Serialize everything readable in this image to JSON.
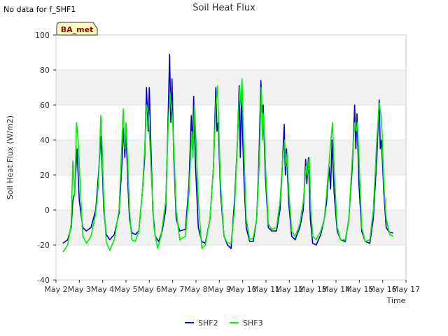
{
  "no_data_note": "No data for f_SHF1",
  "chart_data": {
    "type": "line",
    "title": "Soil Heat Flux",
    "xlabel": "Time",
    "ylabel": "Soil Heat Flux (W/m2)",
    "site_badge": "BA_met",
    "x_ticks": [
      "May 2",
      "May 3",
      "May 4",
      "May 5",
      "May 6",
      "May 7",
      "May 8",
      "May 9",
      "May 10",
      "May 11",
      "May 12",
      "May 13",
      "May 14",
      "May 15",
      "May 16",
      "May 17"
    ],
    "y_ticks": [
      "-40",
      "-20",
      "0",
      "20",
      "40",
      "60",
      "80",
      "100"
    ],
    "xlim": [
      2,
      17
    ],
    "ylim": [
      -40,
      100
    ],
    "grid": "horizontal bands",
    "legend_position": "bottom-center",
    "series": [
      {
        "name": "SHF2",
        "color": "#0000cc",
        "points": [
          [
            2.3,
            -19
          ],
          [
            2.5,
            -17
          ],
          [
            2.65,
            -10
          ],
          [
            2.72,
            5
          ],
          [
            2.8,
            10
          ],
          [
            2.9,
            35
          ],
          [
            2.95,
            20
          ],
          [
            3.0,
            5
          ],
          [
            3.15,
            -10
          ],
          [
            3.3,
            -12
          ],
          [
            3.5,
            -10
          ],
          [
            3.7,
            0
          ],
          [
            3.82,
            20
          ],
          [
            3.92,
            42
          ],
          [
            3.98,
            25
          ],
          [
            4.05,
            0
          ],
          [
            4.15,
            -14
          ],
          [
            4.3,
            -17
          ],
          [
            4.5,
            -14
          ],
          [
            4.7,
            -2
          ],
          [
            4.8,
            20
          ],
          [
            4.9,
            47
          ],
          [
            4.95,
            30
          ],
          [
            5.0,
            45
          ],
          [
            5.08,
            15
          ],
          [
            5.15,
            -5
          ],
          [
            5.25,
            -13
          ],
          [
            5.4,
            -14
          ],
          [
            5.55,
            -12
          ],
          [
            5.7,
            10
          ],
          [
            5.8,
            30
          ],
          [
            5.88,
            70
          ],
          [
            5.95,
            45
          ],
          [
            6.0,
            70
          ],
          [
            6.08,
            30
          ],
          [
            6.15,
            0
          ],
          [
            6.25,
            -15
          ],
          [
            6.4,
            -18
          ],
          [
            6.55,
            -12
          ],
          [
            6.7,
            0
          ],
          [
            6.8,
            50
          ],
          [
            6.87,
            89
          ],
          [
            6.92,
            50
          ],
          [
            6.97,
            75
          ],
          [
            7.05,
            30
          ],
          [
            7.15,
            -5
          ],
          [
            7.3,
            -12
          ],
          [
            7.55,
            -11
          ],
          [
            7.7,
            15
          ],
          [
            7.8,
            54
          ],
          [
            7.85,
            35
          ],
          [
            7.9,
            65
          ],
          [
            7.98,
            25
          ],
          [
            8.1,
            -10
          ],
          [
            8.25,
            -18
          ],
          [
            8.4,
            -19
          ],
          [
            8.6,
            -5
          ],
          [
            8.75,
            25
          ],
          [
            8.85,
            70
          ],
          [
            8.9,
            45
          ],
          [
            8.95,
            50
          ],
          [
            9.05,
            10
          ],
          [
            9.2,
            -15
          ],
          [
            9.35,
            -20
          ],
          [
            9.5,
            -22
          ],
          [
            9.65,
            5
          ],
          [
            9.78,
            40
          ],
          [
            9.85,
            71
          ],
          [
            9.9,
            30
          ],
          [
            9.95,
            65
          ],
          [
            10.05,
            20
          ],
          [
            10.15,
            -10
          ],
          [
            10.3,
            -18
          ],
          [
            10.45,
            -18
          ],
          [
            10.6,
            -5
          ],
          [
            10.7,
            30
          ],
          [
            10.78,
            74
          ],
          [
            10.83,
            55
          ],
          [
            10.88,
            60
          ],
          [
            10.97,
            20
          ],
          [
            11.1,
            -10
          ],
          [
            11.25,
            -12
          ],
          [
            11.45,
            -12
          ],
          [
            11.6,
            0
          ],
          [
            11.7,
            25
          ],
          [
            11.78,
            49
          ],
          [
            11.83,
            20
          ],
          [
            11.88,
            35
          ],
          [
            11.97,
            5
          ],
          [
            12.1,
            -15
          ],
          [
            12.25,
            -17
          ],
          [
            12.45,
            -10
          ],
          [
            12.6,
            0
          ],
          [
            12.7,
            29
          ],
          [
            12.75,
            15
          ],
          [
            12.82,
            30
          ],
          [
            12.9,
            -5
          ],
          [
            13.0,
            -19
          ],
          [
            13.15,
            -20
          ],
          [
            13.35,
            -14
          ],
          [
            13.5,
            -5
          ],
          [
            13.6,
            5
          ],
          [
            13.7,
            25
          ],
          [
            13.77,
            12
          ],
          [
            13.83,
            40
          ],
          [
            13.92,
            10
          ],
          [
            14.05,
            -12
          ],
          [
            14.2,
            -17
          ],
          [
            14.4,
            -18
          ],
          [
            14.55,
            -5
          ],
          [
            14.7,
            25
          ],
          [
            14.8,
            60
          ],
          [
            14.85,
            35
          ],
          [
            14.9,
            55
          ],
          [
            14.98,
            15
          ],
          [
            15.1,
            -12
          ],
          [
            15.25,
            -18
          ],
          [
            15.45,
            -19
          ],
          [
            15.6,
            -5
          ],
          [
            15.75,
            30
          ],
          [
            15.85,
            63
          ],
          [
            15.9,
            35
          ],
          [
            15.95,
            40
          ],
          [
            16.05,
            10
          ],
          [
            16.15,
            -10
          ],
          [
            16.3,
            -13
          ],
          [
            16.45,
            -13
          ]
        ]
      },
      {
        "name": "SHF3",
        "color": "#00ee00",
        "points": [
          [
            2.3,
            -24
          ],
          [
            2.5,
            -20
          ],
          [
            2.65,
            -8
          ],
          [
            2.72,
            28
          ],
          [
            2.8,
            8
          ],
          [
            2.88,
            50
          ],
          [
            2.95,
            40
          ],
          [
            3.05,
            10
          ],
          [
            3.15,
            -15
          ],
          [
            3.3,
            -19
          ],
          [
            3.5,
            -15
          ],
          [
            3.7,
            -2
          ],
          [
            3.82,
            15
          ],
          [
            3.92,
            54
          ],
          [
            3.98,
            35
          ],
          [
            4.05,
            5
          ],
          [
            4.15,
            -18
          ],
          [
            4.3,
            -23
          ],
          [
            4.5,
            -17
          ],
          [
            4.7,
            0
          ],
          [
            4.8,
            30
          ],
          [
            4.88,
            58
          ],
          [
            4.95,
            35
          ],
          [
            5.0,
            50
          ],
          [
            5.08,
            25
          ],
          [
            5.15,
            0
          ],
          [
            5.25,
            -17
          ],
          [
            5.4,
            -18
          ],
          [
            5.55,
            -12
          ],
          [
            5.7,
            10
          ],
          [
            5.8,
            35
          ],
          [
            5.88,
            60
          ],
          [
            5.95,
            55
          ],
          [
            6.02,
            40
          ],
          [
            6.1,
            15
          ],
          [
            6.2,
            -10
          ],
          [
            6.35,
            -22
          ],
          [
            6.5,
            -15
          ],
          [
            6.7,
            5
          ],
          [
            6.8,
            45
          ],
          [
            6.88,
            67
          ],
          [
            6.93,
            60
          ],
          [
            6.98,
            55
          ],
          [
            7.05,
            35
          ],
          [
            7.15,
            0
          ],
          [
            7.3,
            -17
          ],
          [
            7.55,
            -15
          ],
          [
            7.7,
            10
          ],
          [
            7.82,
            45
          ],
          [
            7.87,
            30
          ],
          [
            7.93,
            60
          ],
          [
            8.0,
            40
          ],
          [
            8.1,
            5
          ],
          [
            8.25,
            -22
          ],
          [
            8.4,
            -20
          ],
          [
            8.6,
            -5
          ],
          [
            8.75,
            25
          ],
          [
            8.85,
            60
          ],
          [
            8.92,
            71
          ],
          [
            8.98,
            45
          ],
          [
            9.05,
            15
          ],
          [
            9.2,
            -15
          ],
          [
            9.35,
            -19
          ],
          [
            9.5,
            -19
          ],
          [
            9.65,
            0
          ],
          [
            9.78,
            40
          ],
          [
            9.87,
            70
          ],
          [
            9.92,
            60
          ],
          [
            9.97,
            75
          ],
          [
            10.05,
            35
          ],
          [
            10.15,
            -5
          ],
          [
            10.3,
            -17
          ],
          [
            10.45,
            -16
          ],
          [
            10.6,
            -5
          ],
          [
            10.72,
            30
          ],
          [
            10.8,
            70
          ],
          [
            10.85,
            40
          ],
          [
            10.9,
            55
          ],
          [
            10.98,
            25
          ],
          [
            11.1,
            -8
          ],
          [
            11.25,
            -11
          ],
          [
            11.45,
            -10
          ],
          [
            11.6,
            5
          ],
          [
            11.72,
            30
          ],
          [
            11.8,
            40
          ],
          [
            11.85,
            25
          ],
          [
            11.9,
            32
          ],
          [
            11.98,
            10
          ],
          [
            12.1,
            -12
          ],
          [
            12.25,
            -15
          ],
          [
            12.45,
            -8
          ],
          [
            12.6,
            5
          ],
          [
            12.72,
            25
          ],
          [
            12.78,
            20
          ],
          [
            12.85,
            30
          ],
          [
            12.92,
            0
          ],
          [
            13.0,
            -15
          ],
          [
            13.15,
            -17
          ],
          [
            13.35,
            -12
          ],
          [
            13.5,
            -5
          ],
          [
            13.6,
            10
          ],
          [
            13.72,
            30
          ],
          [
            13.78,
            40
          ],
          [
            13.85,
            50
          ],
          [
            13.93,
            20
          ],
          [
            14.05,
            -10
          ],
          [
            14.2,
            -17
          ],
          [
            14.4,
            -17
          ],
          [
            14.55,
            -5
          ],
          [
            14.7,
            30
          ],
          [
            14.8,
            50
          ],
          [
            14.87,
            45
          ],
          [
            14.92,
            50
          ],
          [
            15.0,
            25
          ],
          [
            15.1,
            -10
          ],
          [
            15.25,
            -18
          ],
          [
            15.45,
            -17
          ],
          [
            15.6,
            0
          ],
          [
            15.75,
            40
          ],
          [
            15.85,
            61
          ],
          [
            15.92,
            55
          ],
          [
            15.97,
            45
          ],
          [
            16.05,
            15
          ],
          [
            16.15,
            -5
          ],
          [
            16.3,
            -14
          ],
          [
            16.45,
            -15
          ]
        ]
      }
    ]
  }
}
